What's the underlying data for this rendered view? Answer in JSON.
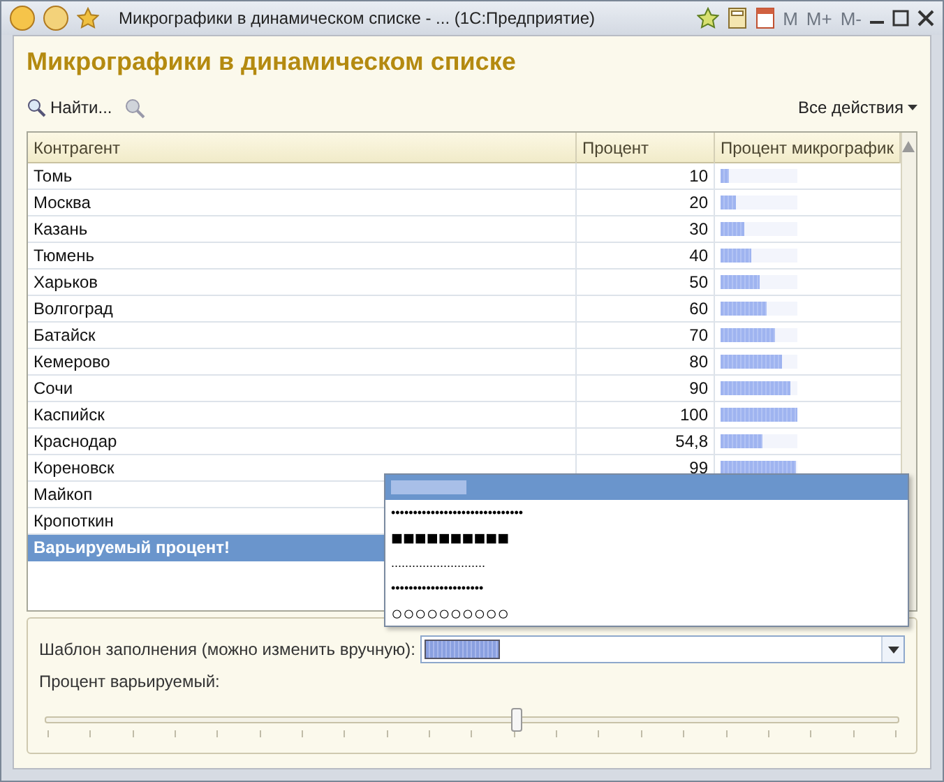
{
  "window": {
    "title": "Микрографики в динамическом списке - ...  (1С:Предприятие)",
    "buttons": [
      "M",
      "M+",
      "M-"
    ]
  },
  "form_title": "Микрографики в динамическом списке",
  "toolbar": {
    "find": "Найти...",
    "all_actions": "Все действия"
  },
  "table": {
    "columns": [
      "Контрагент",
      "Процент",
      "Процент микрографик"
    ],
    "rows": [
      {
        "name": "Томь",
        "percent": "10",
        "level": 0.1,
        "selected": false
      },
      {
        "name": "Москва",
        "percent": "20",
        "level": 0.2,
        "selected": false
      },
      {
        "name": "Казань",
        "percent": "30",
        "level": 0.3,
        "selected": false
      },
      {
        "name": "Тюмень",
        "percent": "40",
        "level": 0.4,
        "selected": false
      },
      {
        "name": "Харьков",
        "percent": "50",
        "level": 0.5,
        "selected": false
      },
      {
        "name": "Волгоград",
        "percent": "60",
        "level": 0.6,
        "selected": false
      },
      {
        "name": "Батайск",
        "percent": "70",
        "level": 0.7,
        "selected": false
      },
      {
        "name": "Кемерово",
        "percent": "80",
        "level": 0.8,
        "selected": false
      },
      {
        "name": "Сочи",
        "percent": "90",
        "level": 0.9,
        "selected": false
      },
      {
        "name": "Каспийск",
        "percent": "100",
        "level": 1.0,
        "selected": false
      },
      {
        "name": "Краснодар",
        "percent": "54,8",
        "level": 0.55,
        "selected": false
      },
      {
        "name": "Кореновск",
        "percent": "99",
        "level": 0.99,
        "selected": false
      },
      {
        "name": "Майкоп",
        "selected": false
      },
      {
        "name": "Кропоткин",
        "selected": false
      },
      {
        "name": "Варьируемый процент!",
        "selected": true
      }
    ]
  },
  "pattern_field": {
    "label": "Шаблон заполнения (можно изменить вручную):"
  },
  "pattern_options": [
    {
      "kind": "bar",
      "selected": true
    },
    {
      "kind": "text",
      "text": "••••••••••••••••••••••••••••••",
      "selected": false
    },
    {
      "kind": "text",
      "text": "■■■■■■■■■■",
      "selected": false
    },
    {
      "kind": "text",
      "text": "...........................",
      "selected": false
    },
    {
      "kind": "text",
      "text": "•••••••••••••••••••••",
      "selected": false
    },
    {
      "kind": "text",
      "text": "○○○○○○○○○○",
      "selected": false
    }
  ],
  "slider": {
    "label": "Процент варьируемый:",
    "level": 0.55
  }
}
